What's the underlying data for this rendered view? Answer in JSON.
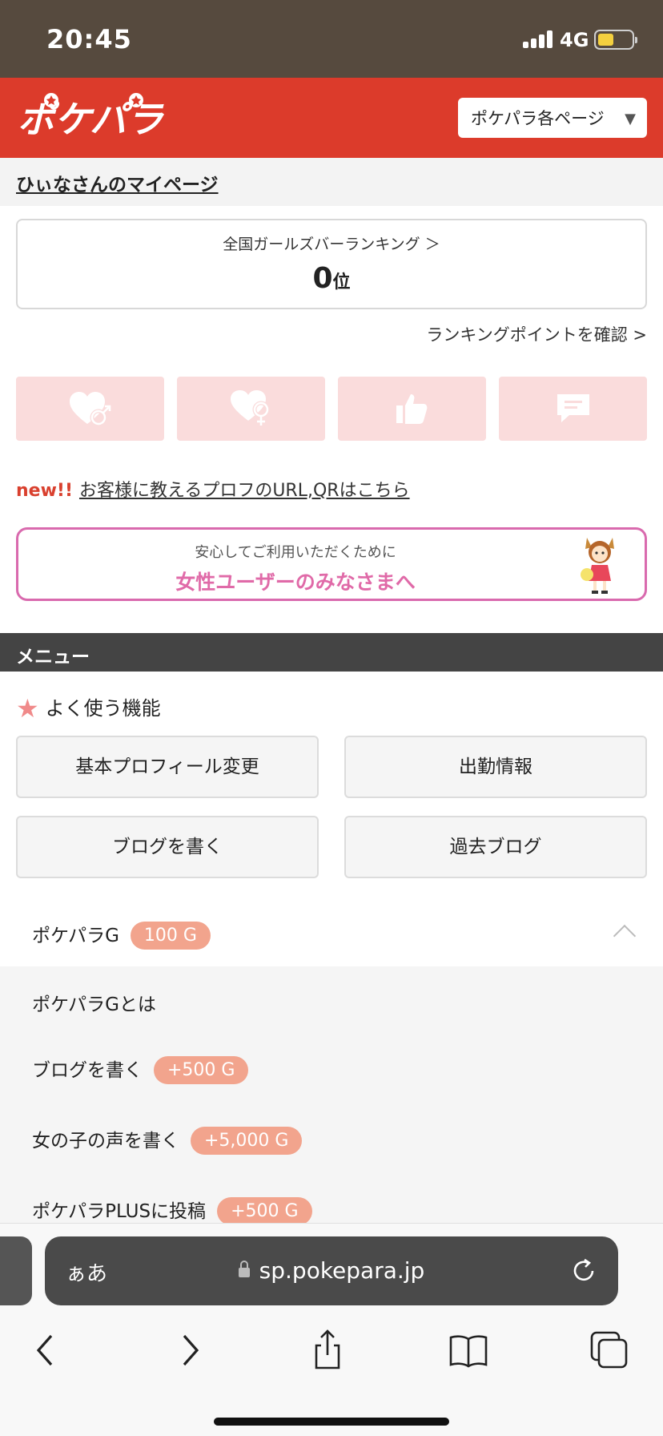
{
  "status_bar": {
    "time": "20:45",
    "network": "4G",
    "battery_level": 0.45
  },
  "header": {
    "logo_text": "ポケパラ",
    "page_select": "ポケパラ各ページ",
    "brand_color": "#dc3b2b"
  },
  "mypage": {
    "link": "ひぃなさんのマイページ"
  },
  "ranking": {
    "title": "全国ガールズバーランキング ＞",
    "value": "0",
    "unit": "位",
    "points_link": "ランキングポイントを確認 >"
  },
  "icon_buttons": [
    "heart-male-icon",
    "heart-female-icon",
    "thumbs-up-icon",
    "message-icon"
  ],
  "notice": {
    "badge": "new!!",
    "link": "お客様に教えるプロフのURL,QRはこちら"
  },
  "women_banner": {
    "subtitle": "安心してご利用いただくために",
    "title": "女性ユーザーのみなさまへ"
  },
  "menu": {
    "header": "メニュー",
    "favorites_title": "よく使う機能",
    "buttons": [
      "基本プロフィール変更",
      "出勤情報",
      "ブログを書く",
      "過去ブログ"
    ]
  },
  "points": {
    "label": "ポケパラG",
    "balance": "100 G",
    "items": [
      {
        "label": "ポケパラGとは",
        "badge": ""
      },
      {
        "label": "ブログを書く",
        "badge": "+500 G"
      },
      {
        "label": "女の子の声を書く",
        "badge": "+5,000 G"
      },
      {
        "label": "ポケパラPLUSに投稿",
        "badge": "+500 G"
      }
    ]
  },
  "browser": {
    "aa": "ぁあ",
    "url": "sp.pokepara.jp"
  }
}
